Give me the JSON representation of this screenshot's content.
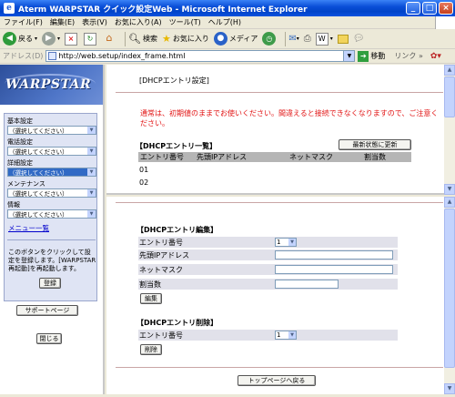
{
  "window": {
    "title": "Aterm WARPSTAR クイック設定Web - Microsoft Internet Explorer"
  },
  "menu": [
    "ファイル(F)",
    "編集(E)",
    "表示(V)",
    "お気に入り(A)",
    "ツール(T)",
    "ヘルプ(H)"
  ],
  "toolbar": {
    "back": "戻る",
    "search": "検索",
    "favorites": "お気に入り",
    "media": "メディア"
  },
  "address": {
    "label": "アドレス(D)",
    "url": "http://web.setup/index_frame.html",
    "go": "移動",
    "links": "リンク"
  },
  "sidebar": {
    "logo": "WARPSTAR",
    "groups": [
      {
        "label": "基本設定",
        "value": "（選択してください）"
      },
      {
        "label": "電話設定",
        "value": "（選択してください）"
      },
      {
        "label": "詳細設定",
        "value": "（選択してください）"
      },
      {
        "label": "メンテナンス",
        "value": "（選択してください）"
      },
      {
        "label": "情報",
        "value": "（選択してください）"
      }
    ],
    "menu_list": "メニュー一覧",
    "note": "このボタンをクリックして設定を登録します。[WARPSTAR再起動]を再起動します。",
    "register_button": "登録",
    "support_button": "サポートページ",
    "close_button": "閉じる"
  },
  "top_frame": {
    "page_title": "[DHCPエントリ設定]",
    "warning": "通常は、初期値のままでお使いください。間違えると接続できなくなりますので、ご注意ください。",
    "list_title": "【DHCPエントリ一覧】",
    "refresh_button": "最新状態に更新",
    "columns": [
      "エントリ番号",
      "先頭IPアドレス",
      "ネットマスク",
      "割当数"
    ],
    "rows": [
      "01",
      "02"
    ]
  },
  "bottom_frame": {
    "edit_title": "【DHCPエントリ編集】",
    "fields": {
      "entry_no": "エントリ番号",
      "entry_no_value": "1",
      "start_ip": "先頭IPアドレス",
      "netmask": "ネットマスク",
      "count": "割当数"
    },
    "edit_button": "編集",
    "delete_title": "【DHCPエントリ削除】",
    "delete_entry_label": "エントリ番号",
    "delete_entry_value": "1",
    "delete_button": "削除",
    "top_button": "トップページへ戻る"
  }
}
